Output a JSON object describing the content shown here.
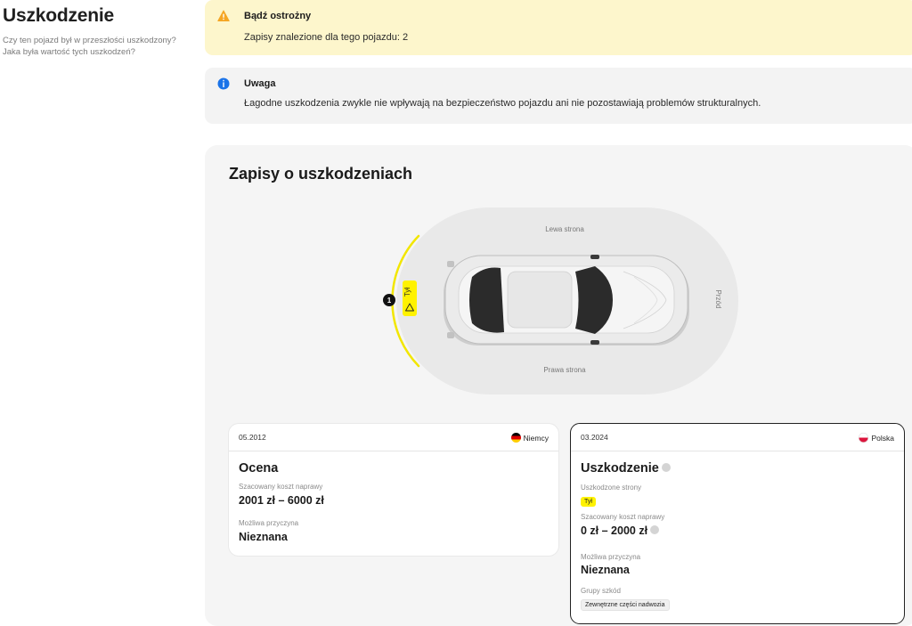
{
  "sidebar": {
    "title": "Uszkodzenie",
    "description": "Czy ten pojazd był w przeszłości uszkodzony? Jaka była wartość tych uszkodzeń?"
  },
  "alerts": {
    "warning": {
      "title": "Bądź ostrożny",
      "message": "Zapisy znalezione dla tego pojazdu: 2"
    },
    "info": {
      "title": "Uwaga",
      "message": "Łagodne uszkodzenia zwykle nie wpływają na bezpieczeństwo pojazdu ani nie pozostawiają problemów strukturalnych."
    }
  },
  "diagram": {
    "title": "Zapisy o uszkodzeniach",
    "left_side": "Lewa strona",
    "right_side": "Prawa strona",
    "front": "Przód",
    "marker_number": "1",
    "marker_label": "Tył"
  },
  "records": [
    {
      "date": "05.2012",
      "country": "Niemcy",
      "heading": "Ocena",
      "cost_label": "Szacowany koszt naprawy",
      "cost": "2001 zł – 6000 zł",
      "cause_label": "Możliwa przyczyna",
      "cause": "Nieznana"
    },
    {
      "date": "03.2024",
      "country": "Polska",
      "heading": "Uszkodzenie",
      "sides_label": "Uszkodzone strony",
      "side_tag": "Tył",
      "cost_label": "Szacowany koszt naprawy",
      "cost": "0 zł – 2000 zł",
      "cause_label": "Możliwa przyczyna",
      "cause": "Nieznana",
      "groups_label": "Grupy szkód",
      "group_tag": "Zewnętrzne części nadwozia"
    }
  ],
  "colors": {
    "warning_bg": "#fdf6cc",
    "warning_icon": "#f5a623",
    "info_icon": "#1a73e8",
    "highlight_yellow": "#fff200"
  }
}
